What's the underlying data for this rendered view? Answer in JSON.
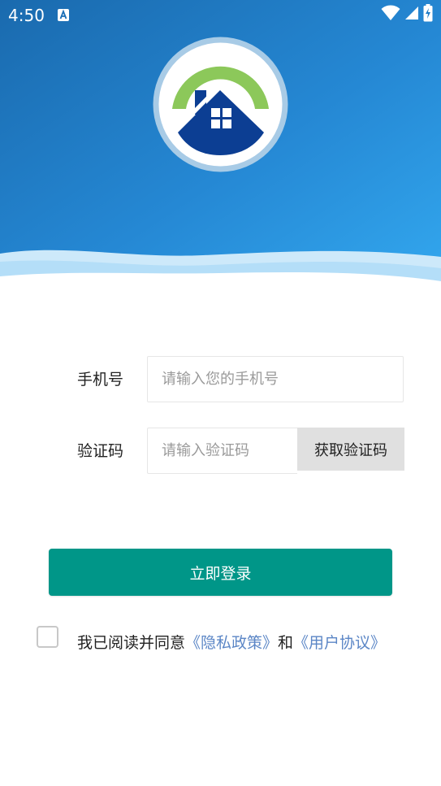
{
  "status_bar": {
    "time": "4:50",
    "notification_icon": "a-letter-icon",
    "icons": [
      "wifi-icon",
      "cell-signal-icon",
      "battery-charging-icon"
    ]
  },
  "colors": {
    "header_gradient_start": "#1a6fb8",
    "header_gradient_end": "#2fa3ea",
    "wave_light": "#bfe2f8",
    "primary_button": "#009688",
    "link": "#5b86c6",
    "get_code_bg": "#e0e0e0"
  },
  "logo": {
    "icon": "house-logo-icon"
  },
  "form": {
    "phone": {
      "label": "手机号",
      "placeholder": "请输入您的手机号",
      "value": ""
    },
    "code": {
      "label": "验证码",
      "placeholder": "请输入验证码",
      "value": "",
      "get_code_label": "获取验证码"
    }
  },
  "login_button": {
    "label": "立即登录"
  },
  "agreement": {
    "checked": false,
    "prefix": "我已阅读并同意",
    "privacy_link": "《隐私政策》",
    "conjunction": "和",
    "terms_link": "《用户协议》"
  }
}
